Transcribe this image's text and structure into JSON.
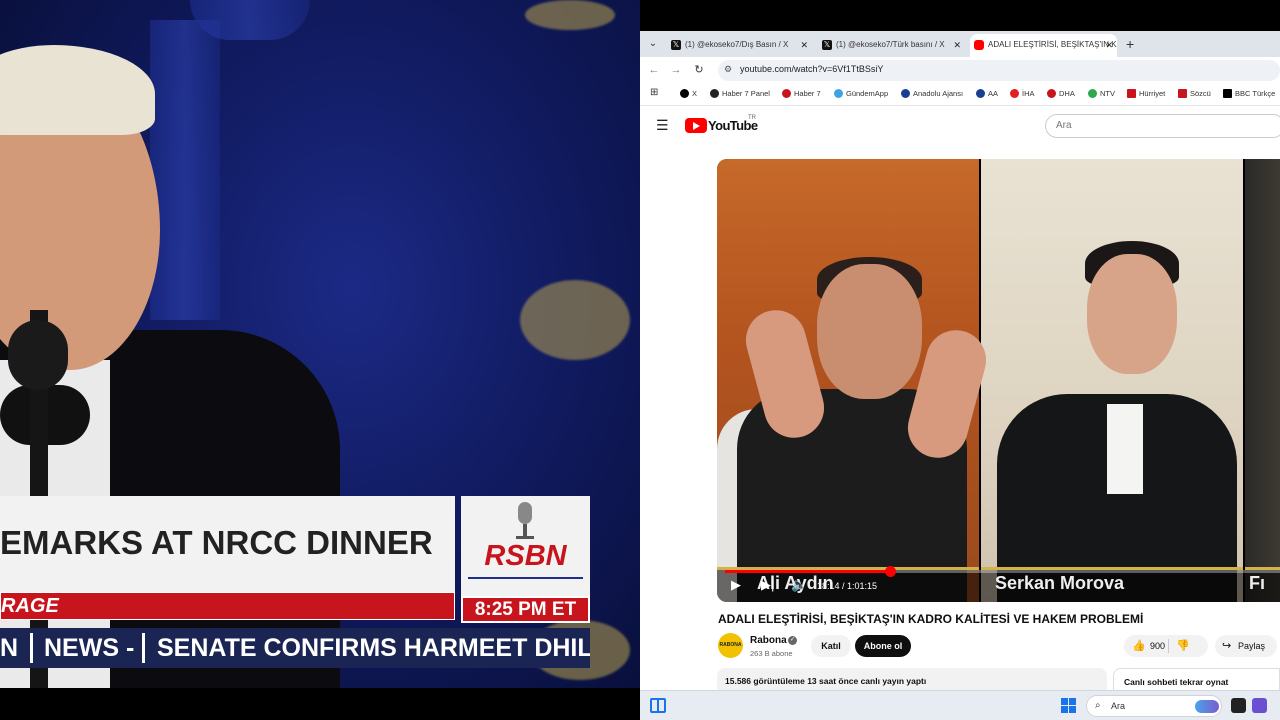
{
  "broadcast": {
    "title": "EMARKS AT NRCC DINNER",
    "red_banner": "RAGE",
    "logo": "RSBN",
    "time": "8:25 PM ET",
    "ticker_left": "N",
    "ticker_mid": "NEWS -",
    "ticker_right": "SENATE CONFIRMS HARMEET DHILLO"
  },
  "browser": {
    "tabs": [
      {
        "label": "(1) @ekoseko7/Dış Basın / X",
        "close": "✕"
      },
      {
        "label": "(1) @ekoseko7/Türk basını / X",
        "close": "✕"
      },
      {
        "label": "ADALI ELEŞTİRİSİ, BEŞİKTAŞ'IN K",
        "close": "✕"
      }
    ],
    "tab_add": "+",
    "url": "youtube.com/watch?v=6Vf1TtBSsiY",
    "bookmarks": [
      {
        "label": "X",
        "color": "#000000"
      },
      {
        "label": "Haber 7 Panel",
        "color": "#222222"
      },
      {
        "label": "Haber 7",
        "color": "#c8141c"
      },
      {
        "label": "GündemApp",
        "color": "#3fa3e0"
      },
      {
        "label": "Anadolu Ajansı",
        "color": "#1b3f8f"
      },
      {
        "label": "AA",
        "color": "#1b3f8f"
      },
      {
        "label": "İHA",
        "color": "#e02020"
      },
      {
        "label": "DHA",
        "color": "#c8141c"
      },
      {
        "label": "NTV",
        "color": "#2fa84f"
      },
      {
        "label": "Hürriyet",
        "color": "#c8141c"
      },
      {
        "label": "Sözcü",
        "color": "#c8141c"
      },
      {
        "label": "BBC Türkçe",
        "color": "#000000"
      }
    ]
  },
  "youtube": {
    "logo_word": "YouTube",
    "country": "TR",
    "search_placeholder": "Ara",
    "player": {
      "name1": "Ali Aydın",
      "name2": "Serkan Morova",
      "name3": "Fı",
      "time": "18:14 / 1:01:15",
      "progress": 0.297
    },
    "video_title": "ADALI ELEŞTİRİSİ, BEŞİKTAŞ'IN KADRO KALİTESİ VE HAKEM PROBLEMİ",
    "channel": {
      "avatar_text": "RABONA",
      "name": "Rabona",
      "subs": "263 B abone",
      "join": "Katıl",
      "subscribe": "Abone ol"
    },
    "likes": "900",
    "share": "Paylaş",
    "description": "15.586 görüntüleme  13 saat önce canlı yayın yaptı",
    "chat_replay": "Canlı sohbeti tekrar oynat"
  },
  "taskbar": {
    "search": "Ara"
  }
}
